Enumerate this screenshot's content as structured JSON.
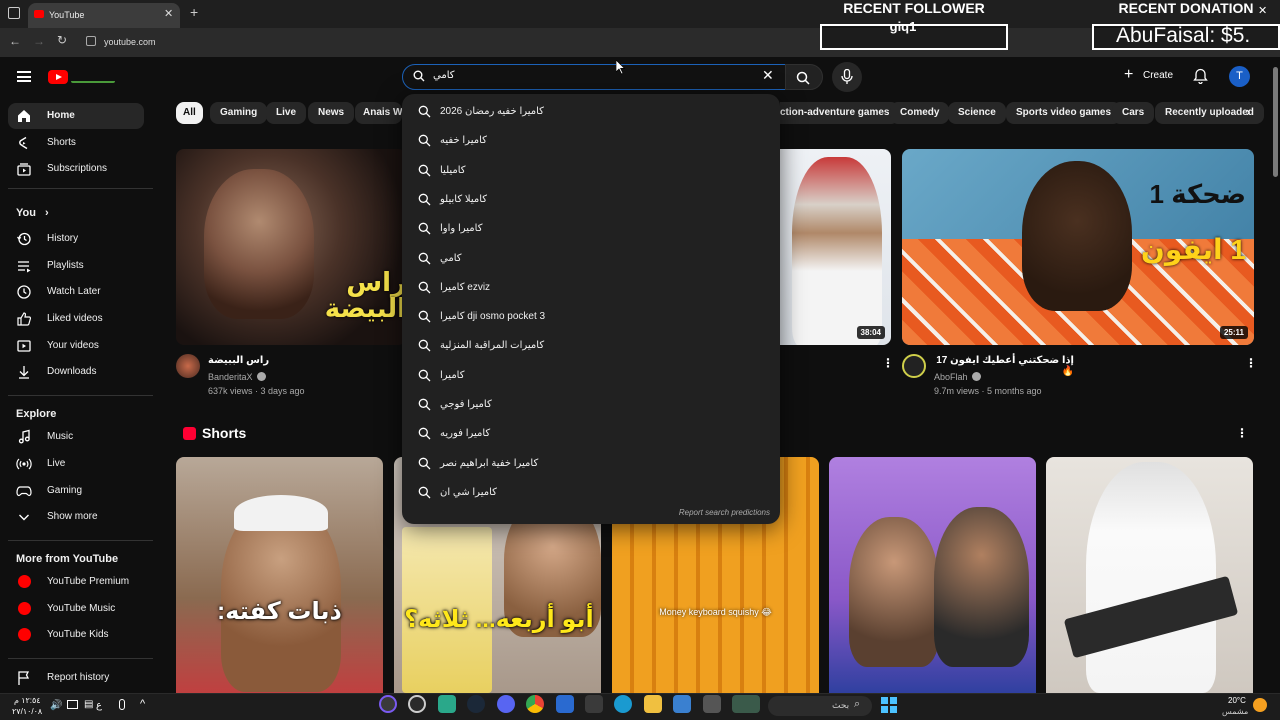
{
  "browser": {
    "tab_title": "YouTube",
    "url": "youtube.com"
  },
  "stream_overlay": {
    "recent_follower_title": "RECENT FOLLOWER",
    "recent_follower_name": "giq1",
    "recent_donation_title": "RECENT DONATION",
    "recent_donation_text": "AbuFaisal: $5."
  },
  "header": {
    "search_value": "كامي",
    "create_label": "Create",
    "avatar_letter": "T"
  },
  "chips": [
    "All",
    "Gaming",
    "Live",
    "News",
    "Anais Wa",
    "ction-adventure games",
    "Comedy",
    "Science",
    "Sports video games",
    "Cars",
    "Recently uploaded"
  ],
  "sidebar": {
    "main": [
      {
        "label": "Home",
        "icon": "home-icon"
      },
      {
        "label": "Shorts",
        "icon": "shorts-icon"
      },
      {
        "label": "Subscriptions",
        "icon": "subscriptions-icon"
      }
    ],
    "you_title": "You",
    "you": [
      {
        "label": "History",
        "icon": "history-icon"
      },
      {
        "label": "Playlists",
        "icon": "playlists-icon"
      },
      {
        "label": "Watch Later",
        "icon": "watch-later-icon"
      },
      {
        "label": "Liked videos",
        "icon": "like-icon"
      },
      {
        "label": "Your videos",
        "icon": "your-videos-icon"
      },
      {
        "label": "Downloads",
        "icon": "download-icon"
      }
    ],
    "explore_title": "Explore",
    "explore": [
      {
        "label": "Music",
        "icon": "music-icon"
      },
      {
        "label": "Live",
        "icon": "live-icon"
      },
      {
        "label": "Gaming",
        "icon": "gaming-icon"
      },
      {
        "label": "Show more",
        "icon": "chevron-down-icon"
      }
    ],
    "more_title": "More from YouTube",
    "more": [
      {
        "label": "YouTube Premium",
        "icon": "youtube-premium-icon"
      },
      {
        "label": "YouTube Music",
        "icon": "youtube-music-icon"
      },
      {
        "label": "YouTube Kids",
        "icon": "youtube-kids-icon"
      }
    ],
    "report": {
      "label": "Report history",
      "icon": "flag-icon"
    }
  },
  "suggestions": [
    "كاميرا خفيه رمضان 2026",
    "كاميرا خفيه",
    "كاميليا",
    "كاميلا كابيلو",
    "كاميرا واوا",
    "كامي",
    "كاميرا ezviz",
    "كاميرا dji osmo pocket 3",
    "كاميرات المراقبة المنزلية",
    "كاميرا",
    "كاميرا فوجي",
    "كاميرا فوريه",
    "كاميرا خفية ابراهيم نصر",
    "كاميرا شي ان"
  ],
  "report_predictions": "Report search predictions",
  "videos": [
    {
      "title": "راس الببيضة",
      "channel": "BanderitaX",
      "meta": "637k views · 3 days ago",
      "thumb_text": "راس البيضة"
    },
    {
      "title": "",
      "channel": "",
      "meta": "",
      "duration": "38:04"
    },
    {
      "title": "إذا ضحكتني أعطيك ايفون 17 🔥",
      "channel": "AboFlah",
      "meta": "9.7m views · 5 months ago",
      "duration": "25:11",
      "thumb_text_1": "ضحكة 1",
      "thumb_text_2": "1 ايفون"
    }
  ],
  "shorts": {
    "title": "Shorts",
    "items": [
      {
        "caption": "ذبات كفته:"
      },
      {
        "caption": "أبو أربعه... ثلاثه؟"
      },
      {
        "caption": "Money keyboard squishy 😂"
      },
      {
        "caption": ""
      },
      {
        "caption": ""
      }
    ]
  },
  "taskbar": {
    "time": "١٢:٥٤ م",
    "date": "٢٧/١٠/٠٨",
    "lang": "ع",
    "weather_temp": "20°C",
    "weather_desc": "مشمس",
    "search_placeholder": "بحث"
  },
  "colors": {
    "brand_red": "#ff0000",
    "background": "#0f0f0f",
    "chip_active": "#f1f1f1"
  }
}
